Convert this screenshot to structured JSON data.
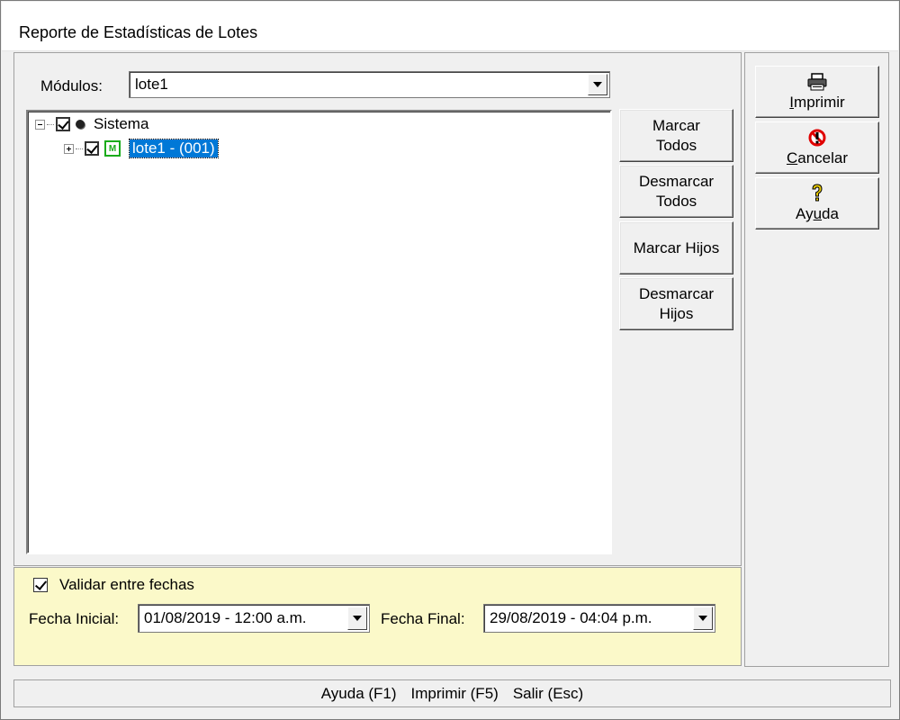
{
  "window": {
    "title": "Reporte de Estadísticas de Lotes"
  },
  "modules": {
    "label": "Módulos:",
    "value": "lote1"
  },
  "tree": {
    "root": {
      "label": "Sistema",
      "checked": true,
      "icon": "sphere-icon"
    },
    "child": {
      "label": "lote1 - (001)",
      "checked": true,
      "icon": "module-icon",
      "icon_text": "M",
      "selected": true
    }
  },
  "selection_buttons": {
    "mark_all": "Marcar Todos",
    "unmark_all": "Desmarcar Todos",
    "mark_children": "Marcar Hijos",
    "unmark_children": "Desmarcar Hijos"
  },
  "dates": {
    "validate_label": "Validar entre fechas",
    "validate_checked": true,
    "start_label": "Fecha Inicial:",
    "start_value": "01/08/2019 - 12:00 a.m.",
    "end_label": "Fecha Final:",
    "end_value": "29/08/2019 - 04:04 p.m."
  },
  "actions": {
    "print": {
      "label": "Imprimir",
      "underline": "I",
      "rest": "mprimir",
      "icon": "printer-icon"
    },
    "cancel": {
      "label": "Cancelar",
      "underline": "C",
      "rest": "ancelar",
      "icon": "cancel-icon"
    },
    "help": {
      "label": "Ayuda",
      "pre": "Ay",
      "underline": "u",
      "rest": "da",
      "icon": "help-icon"
    }
  },
  "status": {
    "help": "Ayuda (F1)",
    "print": "Imprimir (F5)",
    "exit": "Salir (Esc)"
  },
  "colors": {
    "selection": "#0078d7",
    "date_panel_bg": "#fbf9c9",
    "module_icon": "#1aab1a",
    "cancel_icon": "#e00000",
    "help_icon": "#e6c800"
  }
}
